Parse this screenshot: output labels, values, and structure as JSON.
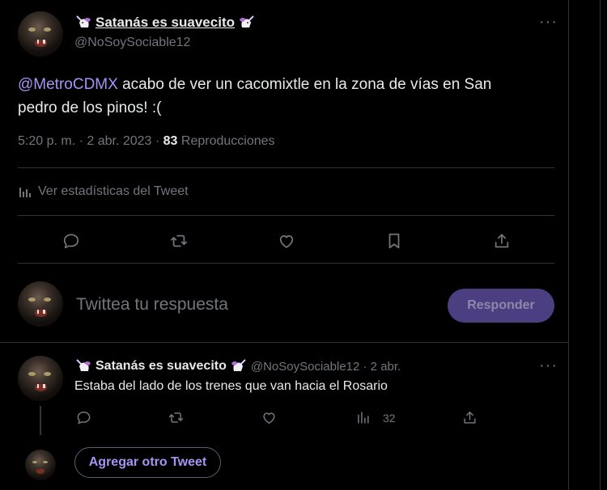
{
  "tweet": {
    "display_name": "Satanás es suavecito",
    "handle": "@NoSoySociable12",
    "mention": "@MetroCDMX",
    "text_line1": " acabo de ver un cacomixtle en la zona de vías en San",
    "text_line2": "pedro de los pinos! :(",
    "time": "5:20 p. m. · 2 abr. 2023 · ",
    "views": "83",
    "views_label": " Reproducciones",
    "stats_label": "Ver estadísticas del Tweet",
    "more": "···"
  },
  "compose": {
    "placeholder": "Twittea tu respuesta",
    "button": "Responder"
  },
  "reply": {
    "display_name": "Satanás es suavecito",
    "handle_date": "@NoSoySociable12 · 2 abr.",
    "text": "Estaba del lado de los trenes que van hacia el Rosario",
    "views": "32",
    "more": "···"
  },
  "add_tweet": "Agregar otro Tweet",
  "icons": [
    "unicorn-icon",
    "more-icon",
    "stats-icon",
    "reply-icon",
    "retweet-icon",
    "like-icon",
    "bookmark-icon",
    "share-icon",
    "views-icon"
  ],
  "colors": {
    "accent": "#a794f2",
    "button_bg": "#4b3f82",
    "muted": "#71767b",
    "text": "#e7e9ea",
    "border": "#2f3336"
  }
}
